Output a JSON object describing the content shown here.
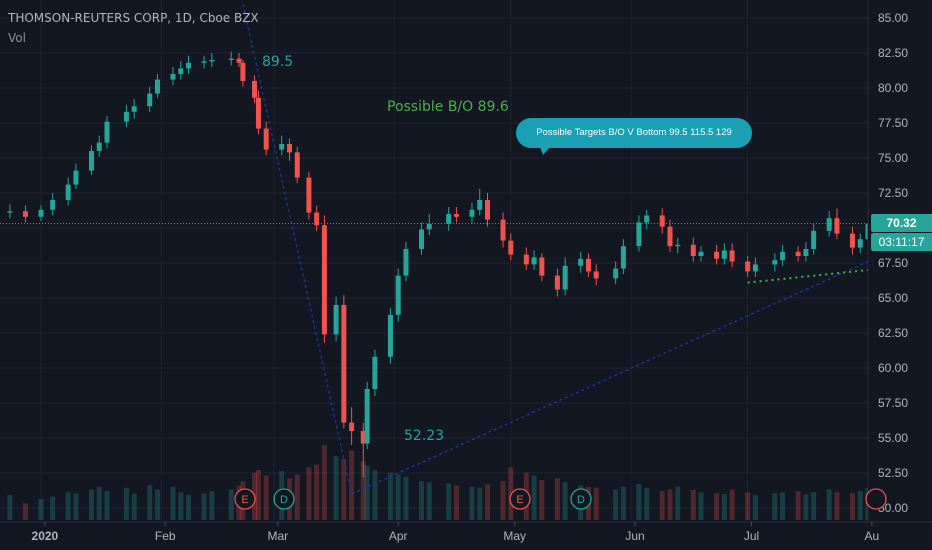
{
  "header": {
    "title": "THOMSON-REUTERS CORP, 1D, Cboe BZX",
    "volume_label": "Vol"
  },
  "annotations": {
    "high_label": "89.5",
    "breakout_label": "Possible B/O  89.6",
    "low_label": "52.23",
    "targets_callout": "Possible Targets B/O V Bottom   99.5   115.5   129"
  },
  "price_axis": {
    "last_price": "70.32",
    "countdown": "03:11:17"
  },
  "events": [
    {
      "month": "Feb",
      "letter": "E"
    },
    {
      "month": "Mar",
      "letter": "D"
    },
    {
      "month": "May",
      "letter": "E"
    },
    {
      "month": "May",
      "letter": "D"
    }
  ],
  "colors": {
    "background": "#131722",
    "up": "#26a69a",
    "down": "#ef5350",
    "grid": "#1f2331",
    "axis_text": "#b2b5be",
    "trendline": "#2133a6",
    "support_dots": "#4caf50",
    "callout": "#1aa0b4",
    "event_e": "#ef5350",
    "event_d": "#26a69a"
  },
  "chart_data": {
    "type": "candlestick",
    "title": "THOMSON-REUTERS CORP, 1D, Cboe BZX",
    "x_ticks": [
      "2020",
      "Feb",
      "Mar",
      "Apr",
      "May",
      "Jun",
      "Jul",
      "Au"
    ],
    "y_ticks": [
      50.0,
      52.5,
      55.0,
      57.5,
      60.0,
      62.5,
      65.0,
      67.5,
      70.0,
      72.5,
      75.0,
      77.5,
      80.0,
      82.5,
      85.0
    ],
    "y_range": [
      49.5,
      86.0
    ],
    "grid": true,
    "series": [
      {
        "name": "price",
        "x": [
          "2019-12-17",
          "2019-12-19",
          "2019-12-23",
          "2019-12-27",
          "2019-12-31",
          "2020-01-03",
          "2020-01-07",
          "2020-01-09",
          "2020-01-13",
          "2020-01-15",
          "2020-01-17",
          "2020-01-22",
          "2020-01-24",
          "2020-01-28",
          "2020-01-30",
          "2020-02-03",
          "2020-02-05",
          "2020-02-07",
          "2020-02-11",
          "2020-02-13",
          "2020-02-18",
          "2020-02-20",
          "2020-02-21",
          "2020-02-24",
          "2020-02-25",
          "2020-02-27",
          "2020-03-02",
          "2020-03-04",
          "2020-03-06",
          "2020-03-09",
          "2020-03-11",
          "2020-03-13",
          "2020-03-16",
          "2020-03-18",
          "2020-03-20",
          "2020-03-23",
          "2020-03-24",
          "2020-03-26",
          "2020-03-30",
          "2020-04-01",
          "2020-04-03",
          "2020-04-07",
          "2020-04-09",
          "2020-04-14",
          "2020-04-16",
          "2020-04-20",
          "2020-04-22",
          "2020-04-24",
          "2020-04-28",
          "2020-04-30",
          "2020-05-04",
          "2020-05-06",
          "2020-05-08",
          "2020-05-12",
          "2020-05-14",
          "2020-05-18",
          "2020-05-20",
          "2020-05-22",
          "2020-05-27",
          "2020-05-29",
          "2020-06-02",
          "2020-06-04",
          "2020-06-08",
          "2020-06-10",
          "2020-06-12",
          "2020-06-16",
          "2020-06-18",
          "2020-06-22",
          "2020-06-24",
          "2020-06-26",
          "2020-06-30",
          "2020-07-02",
          "2020-07-07",
          "2020-07-09",
          "2020-07-13",
          "2020-07-15",
          "2020-07-17",
          "2020-07-21",
          "2020-07-23",
          "2020-07-27",
          "2020-07-29",
          "2020-07-31"
        ],
        "open": [
          71.0,
          70.8,
          71.1,
          71.2,
          70.8,
          71.3,
          72.0,
          73.1,
          74.1,
          75.5,
          76.1,
          77.6,
          78.3,
          78.7,
          79.6,
          80.6,
          81.0,
          81.4,
          81.8,
          81.9,
          82.0,
          82.1,
          81.8,
          80.5,
          79.3,
          77.1,
          75.6,
          76.0,
          75.4,
          73.6,
          71.1,
          70.2,
          62.4,
          64.5,
          56.1,
          55.5,
          54.6,
          58.5,
          60.8,
          63.8,
          66.6,
          68.5,
          69.9,
          70.3,
          71.0,
          70.8,
          71.3,
          72.0,
          70.6,
          69.1,
          68.1,
          67.4,
          67.9,
          66.6,
          65.6,
          67.3,
          67.8,
          66.9,
          66.4,
          67.1,
          68.7,
          70.4,
          70.9,
          70.1,
          68.7,
          68.8,
          68.0,
          68.3,
          67.8,
          68.4,
          67.6,
          66.9,
          67.4,
          67.7,
          68.3,
          68.0,
          68.5,
          69.8,
          70.7,
          69.6,
          68.6,
          69.2
        ],
        "close": [
          70.8,
          71.1,
          71.2,
          70.8,
          71.3,
          72.0,
          73.1,
          74.1,
          75.5,
          76.1,
          77.6,
          78.3,
          78.7,
          79.6,
          80.6,
          81.0,
          81.4,
          81.8,
          81.9,
          82.0,
          82.1,
          81.8,
          80.5,
          79.3,
          77.1,
          75.6,
          76.0,
          75.4,
          73.6,
          71.1,
          70.2,
          62.4,
          64.5,
          56.1,
          55.5,
          54.6,
          58.5,
          60.8,
          63.8,
          66.6,
          68.5,
          69.9,
          70.3,
          71.0,
          70.8,
          71.3,
          72.0,
          70.6,
          69.1,
          68.1,
          67.4,
          67.9,
          66.6,
          65.6,
          67.3,
          67.8,
          66.9,
          66.4,
          67.1,
          68.7,
          70.4,
          70.9,
          70.1,
          68.7,
          68.8,
          68.0,
          68.3,
          67.8,
          68.4,
          67.6,
          66.9,
          67.4,
          67.7,
          68.3,
          68.0,
          68.5,
          69.8,
          70.7,
          69.6,
          68.6,
          69.2,
          70.3
        ],
        "high": [
          71.6,
          71.5,
          71.7,
          71.6,
          71.6,
          72.5,
          73.6,
          74.6,
          75.9,
          76.6,
          78.0,
          78.8,
          79.2,
          80.1,
          81.0,
          81.5,
          81.9,
          82.3,
          82.3,
          82.5,
          82.6,
          82.5,
          82.0,
          80.9,
          79.8,
          77.6,
          76.6,
          76.4,
          75.8,
          74.0,
          71.6,
          70.9,
          65.1,
          65.2,
          57.2,
          56.1,
          59.0,
          61.3,
          64.3,
          67.1,
          69.0,
          70.4,
          71.0,
          71.5,
          71.5,
          71.8,
          72.8,
          72.5,
          71.1,
          69.6,
          68.6,
          68.4,
          68.2,
          67.1,
          67.9,
          68.3,
          68.2,
          67.4,
          67.6,
          69.2,
          70.9,
          71.3,
          71.4,
          70.6,
          69.3,
          69.3,
          68.7,
          68.8,
          68.9,
          68.9,
          68.0,
          67.9,
          68.2,
          68.8,
          68.7,
          69.0,
          70.3,
          71.2,
          71.4,
          70.1,
          69.6,
          70.7
        ],
        "low": [
          70.3,
          70.4,
          70.7,
          70.4,
          70.5,
          70.9,
          71.6,
          72.8,
          73.8,
          75.1,
          75.7,
          77.2,
          77.8,
          78.3,
          79.3,
          80.2,
          80.6,
          81.0,
          81.4,
          81.5,
          81.6,
          81.5,
          80.1,
          78.9,
          76.7,
          75.2,
          75.2,
          74.8,
          73.2,
          70.6,
          69.8,
          61.8,
          61.9,
          55.7,
          54.5,
          52.2,
          54.2,
          58.0,
          60.3,
          63.3,
          66.2,
          68.1,
          69.5,
          69.8,
          70.4,
          70.3,
          70.9,
          70.1,
          68.6,
          67.7,
          67.0,
          67.0,
          66.2,
          65.1,
          65.2,
          66.8,
          66.5,
          65.9,
          66.0,
          66.7,
          68.3,
          69.9,
          69.6,
          68.3,
          68.2,
          67.6,
          67.6,
          67.4,
          67.4,
          67.2,
          66.5,
          66.5,
          66.9,
          67.3,
          67.6,
          67.6,
          68.1,
          69.4,
          69.2,
          68.1,
          68.2,
          68.8
        ],
        "volume": [
          0.4,
          0.35,
          0.45,
          0.3,
          0.38,
          0.42,
          0.5,
          0.48,
          0.55,
          0.6,
          0.52,
          0.58,
          0.47,
          0.63,
          0.55,
          0.6,
          0.5,
          0.45,
          0.48,
          0.52,
          0.55,
          0.62,
          0.7,
          0.85,
          0.9,
          0.8,
          0.88,
          0.75,
          0.82,
          0.95,
          1.0,
          1.35,
          1.15,
          1.1,
          1.25,
          1.05,
          0.98,
          0.9,
          0.85,
          0.82,
          0.78,
          0.7,
          0.68,
          0.66,
          0.62,
          0.6,
          0.58,
          0.64,
          0.7,
          0.95,
          0.85,
          0.8,
          0.72,
          0.75,
          0.68,
          0.62,
          0.6,
          0.58,
          0.55,
          0.6,
          0.65,
          0.58,
          0.52,
          0.55,
          0.6,
          0.54,
          0.5,
          0.48,
          0.47,
          0.55,
          0.5,
          0.45,
          0.48,
          0.5,
          0.52,
          0.46,
          0.5,
          0.55,
          0.5,
          0.48,
          0.52,
          0.58
        ]
      }
    ],
    "horizontal_line": 70.32,
    "trendlines": [
      {
        "style": "dotted-blue",
        "points": [
          [
            "2020-02-21",
            86.0
          ],
          [
            "2020-03-20",
            51.0
          ]
        ]
      },
      {
        "style": "dotted-blue",
        "points": [
          [
            "2020-03-20",
            51.0
          ],
          [
            "2020-07-31",
            67.6
          ]
        ]
      },
      {
        "style": "dotted-green",
        "points": [
          [
            "2020-06-30",
            66.1
          ],
          [
            "2020-07-31",
            67.0
          ]
        ]
      }
    ]
  }
}
